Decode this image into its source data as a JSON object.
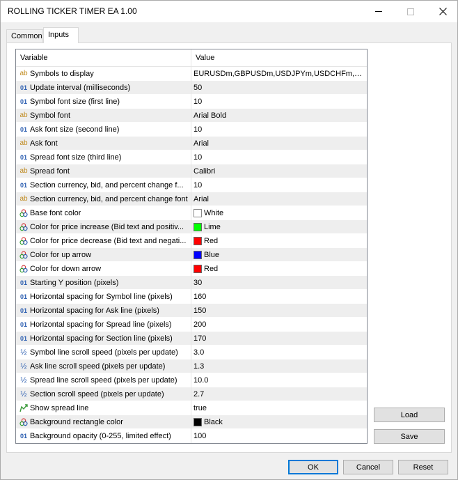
{
  "window": {
    "title": "ROLLING TICKER TIMER EA 1.00"
  },
  "tabs": [
    {
      "label": "Common",
      "active": false
    },
    {
      "label": "Inputs",
      "active": true
    }
  ],
  "grid": {
    "headers": {
      "variable": "Variable",
      "value": "Value"
    },
    "rows": [
      {
        "type": "string",
        "icon": "string-type-icon",
        "variable": "Symbols to display",
        "value": "EURUSDm,GBPUSDm,USDJPYm,USDCHFm,AUDU..."
      },
      {
        "type": "int",
        "icon": "integer-type-icon",
        "variable": "Update interval (milliseconds)",
        "value": "50"
      },
      {
        "type": "int",
        "icon": "integer-type-icon",
        "variable": "Symbol font size (first line)",
        "value": "10"
      },
      {
        "type": "string",
        "icon": "string-type-icon",
        "variable": "Symbol font",
        "value": "Arial Bold"
      },
      {
        "type": "int",
        "icon": "integer-type-icon",
        "variable": "Ask font size (second line)",
        "value": "10"
      },
      {
        "type": "string",
        "icon": "string-type-icon",
        "variable": "Ask font",
        "value": "Arial"
      },
      {
        "type": "int",
        "icon": "integer-type-icon",
        "variable": "Spread font size (third line)",
        "value": "10"
      },
      {
        "type": "string",
        "icon": "string-type-icon",
        "variable": "Spread font",
        "value": "Calibri"
      },
      {
        "type": "int",
        "icon": "integer-type-icon",
        "variable": "Section currency, bid, and percent change f...",
        "value": "10"
      },
      {
        "type": "string",
        "icon": "string-type-icon",
        "variable": "Section currency, bid, and percent change font",
        "value": "Arial"
      },
      {
        "type": "color",
        "icon": "color-type-icon",
        "variable": "Base font color",
        "value": "White",
        "color": "#ffffff"
      },
      {
        "type": "color",
        "icon": "color-type-icon",
        "variable": "Color for price increase (Bid text and positiv...",
        "value": "Lime",
        "color": "#00ff00"
      },
      {
        "type": "color",
        "icon": "color-type-icon",
        "variable": "Color for price decrease (Bid text and negati...",
        "value": "Red",
        "color": "#ff0000"
      },
      {
        "type": "color",
        "icon": "color-type-icon",
        "variable": "Color for up arrow",
        "value": "Blue",
        "color": "#0000ff"
      },
      {
        "type": "color",
        "icon": "color-type-icon",
        "variable": "Color for down arrow",
        "value": "Red",
        "color": "#ff0000"
      },
      {
        "type": "int",
        "icon": "integer-type-icon",
        "variable": "Starting Y position (pixels)",
        "value": "30"
      },
      {
        "type": "int",
        "icon": "integer-type-icon",
        "variable": "Horizontal spacing for Symbol line (pixels)",
        "value": "160"
      },
      {
        "type": "int",
        "icon": "integer-type-icon",
        "variable": "Horizontal spacing for Ask line (pixels)",
        "value": "150"
      },
      {
        "type": "int",
        "icon": "integer-type-icon",
        "variable": "Horizontal spacing for Spread line (pixels)",
        "value": "200"
      },
      {
        "type": "int",
        "icon": "integer-type-icon",
        "variable": "Horizontal spacing for Section line (pixels)",
        "value": "170"
      },
      {
        "type": "double",
        "icon": "double-type-icon",
        "variable": "Symbol line scroll speed (pixels per update)",
        "value": "3.0"
      },
      {
        "type": "double",
        "icon": "double-type-icon",
        "variable": "Ask line scroll speed (pixels per update)",
        "value": "1.3"
      },
      {
        "type": "double",
        "icon": "double-type-icon",
        "variable": "Spread line scroll speed (pixels per update)",
        "value": "10.0"
      },
      {
        "type": "double",
        "icon": "double-type-icon",
        "variable": "Section scroll speed (pixels per update)",
        "value": "2.7"
      },
      {
        "type": "bool",
        "icon": "bool-type-icon",
        "variable": "Show spread line",
        "value": "true"
      },
      {
        "type": "color",
        "icon": "color-type-icon",
        "variable": "Background rectangle color",
        "value": "Black",
        "color": "#000000"
      },
      {
        "type": "int",
        "icon": "integer-type-icon",
        "variable": "Background opacity (0-255, limited effect)",
        "value": "100"
      }
    ]
  },
  "buttons": {
    "load": "Load",
    "save": "Save",
    "ok": "OK",
    "cancel": "Cancel",
    "reset": "Reset"
  }
}
